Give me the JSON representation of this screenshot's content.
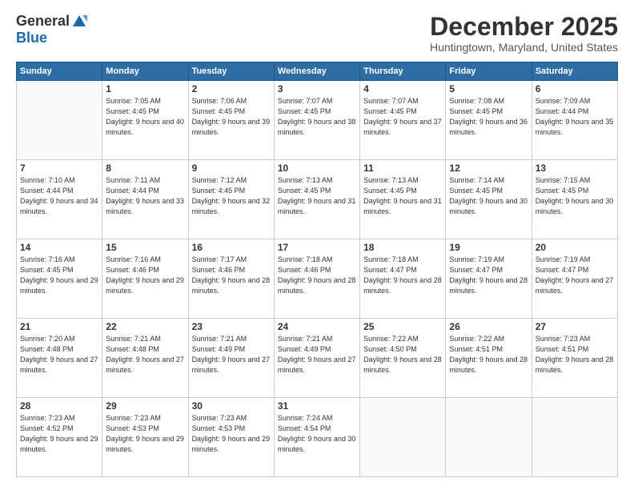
{
  "logo": {
    "general": "General",
    "blue": "Blue"
  },
  "header": {
    "month": "December 2025",
    "location": "Huntingtown, Maryland, United States"
  },
  "days_of_week": [
    "Sunday",
    "Monday",
    "Tuesday",
    "Wednesday",
    "Thursday",
    "Friday",
    "Saturday"
  ],
  "weeks": [
    [
      {
        "num": "",
        "empty": true
      },
      {
        "num": "1",
        "sunrise": "7:05 AM",
        "sunset": "4:45 PM",
        "daylight": "9 hours and 40 minutes."
      },
      {
        "num": "2",
        "sunrise": "7:06 AM",
        "sunset": "4:45 PM",
        "daylight": "9 hours and 39 minutes."
      },
      {
        "num": "3",
        "sunrise": "7:07 AM",
        "sunset": "4:45 PM",
        "daylight": "9 hours and 38 minutes."
      },
      {
        "num": "4",
        "sunrise": "7:07 AM",
        "sunset": "4:45 PM",
        "daylight": "9 hours and 37 minutes."
      },
      {
        "num": "5",
        "sunrise": "7:08 AM",
        "sunset": "4:45 PM",
        "daylight": "9 hours and 36 minutes."
      },
      {
        "num": "6",
        "sunrise": "7:09 AM",
        "sunset": "4:44 PM",
        "daylight": "9 hours and 35 minutes."
      }
    ],
    [
      {
        "num": "7",
        "sunrise": "7:10 AM",
        "sunset": "4:44 PM",
        "daylight": "9 hours and 34 minutes."
      },
      {
        "num": "8",
        "sunrise": "7:11 AM",
        "sunset": "4:44 PM",
        "daylight": "9 hours and 33 minutes."
      },
      {
        "num": "9",
        "sunrise": "7:12 AM",
        "sunset": "4:45 PM",
        "daylight": "9 hours and 32 minutes."
      },
      {
        "num": "10",
        "sunrise": "7:13 AM",
        "sunset": "4:45 PM",
        "daylight": "9 hours and 31 minutes."
      },
      {
        "num": "11",
        "sunrise": "7:13 AM",
        "sunset": "4:45 PM",
        "daylight": "9 hours and 31 minutes."
      },
      {
        "num": "12",
        "sunrise": "7:14 AM",
        "sunset": "4:45 PM",
        "daylight": "9 hours and 30 minutes."
      },
      {
        "num": "13",
        "sunrise": "7:15 AM",
        "sunset": "4:45 PM",
        "daylight": "9 hours and 30 minutes."
      }
    ],
    [
      {
        "num": "14",
        "sunrise": "7:16 AM",
        "sunset": "4:45 PM",
        "daylight": "9 hours and 29 minutes."
      },
      {
        "num": "15",
        "sunrise": "7:16 AM",
        "sunset": "4:46 PM",
        "daylight": "9 hours and 29 minutes."
      },
      {
        "num": "16",
        "sunrise": "7:17 AM",
        "sunset": "4:46 PM",
        "daylight": "9 hours and 28 minutes."
      },
      {
        "num": "17",
        "sunrise": "7:18 AM",
        "sunset": "4:46 PM",
        "daylight": "9 hours and 28 minutes."
      },
      {
        "num": "18",
        "sunrise": "7:18 AM",
        "sunset": "4:47 PM",
        "daylight": "9 hours and 28 minutes."
      },
      {
        "num": "19",
        "sunrise": "7:19 AM",
        "sunset": "4:47 PM",
        "daylight": "9 hours and 28 minutes."
      },
      {
        "num": "20",
        "sunrise": "7:19 AM",
        "sunset": "4:47 PM",
        "daylight": "9 hours and 27 minutes."
      }
    ],
    [
      {
        "num": "21",
        "sunrise": "7:20 AM",
        "sunset": "4:48 PM",
        "daylight": "9 hours and 27 minutes."
      },
      {
        "num": "22",
        "sunrise": "7:21 AM",
        "sunset": "4:48 PM",
        "daylight": "9 hours and 27 minutes."
      },
      {
        "num": "23",
        "sunrise": "7:21 AM",
        "sunset": "4:49 PM",
        "daylight": "9 hours and 27 minutes."
      },
      {
        "num": "24",
        "sunrise": "7:21 AM",
        "sunset": "4:49 PM",
        "daylight": "9 hours and 27 minutes."
      },
      {
        "num": "25",
        "sunrise": "7:22 AM",
        "sunset": "4:50 PM",
        "daylight": "9 hours and 28 minutes."
      },
      {
        "num": "26",
        "sunrise": "7:22 AM",
        "sunset": "4:51 PM",
        "daylight": "9 hours and 28 minutes."
      },
      {
        "num": "27",
        "sunrise": "7:23 AM",
        "sunset": "4:51 PM",
        "daylight": "9 hours and 28 minutes."
      }
    ],
    [
      {
        "num": "28",
        "sunrise": "7:23 AM",
        "sunset": "4:52 PM",
        "daylight": "9 hours and 29 minutes."
      },
      {
        "num": "29",
        "sunrise": "7:23 AM",
        "sunset": "4:53 PM",
        "daylight": "9 hours and 29 minutes."
      },
      {
        "num": "30",
        "sunrise": "7:23 AM",
        "sunset": "4:53 PM",
        "daylight": "9 hours and 29 minutes."
      },
      {
        "num": "31",
        "sunrise": "7:24 AM",
        "sunset": "4:54 PM",
        "daylight": "9 hours and 30 minutes."
      },
      {
        "num": "",
        "empty": true
      },
      {
        "num": "",
        "empty": true
      },
      {
        "num": "",
        "empty": true
      }
    ]
  ]
}
